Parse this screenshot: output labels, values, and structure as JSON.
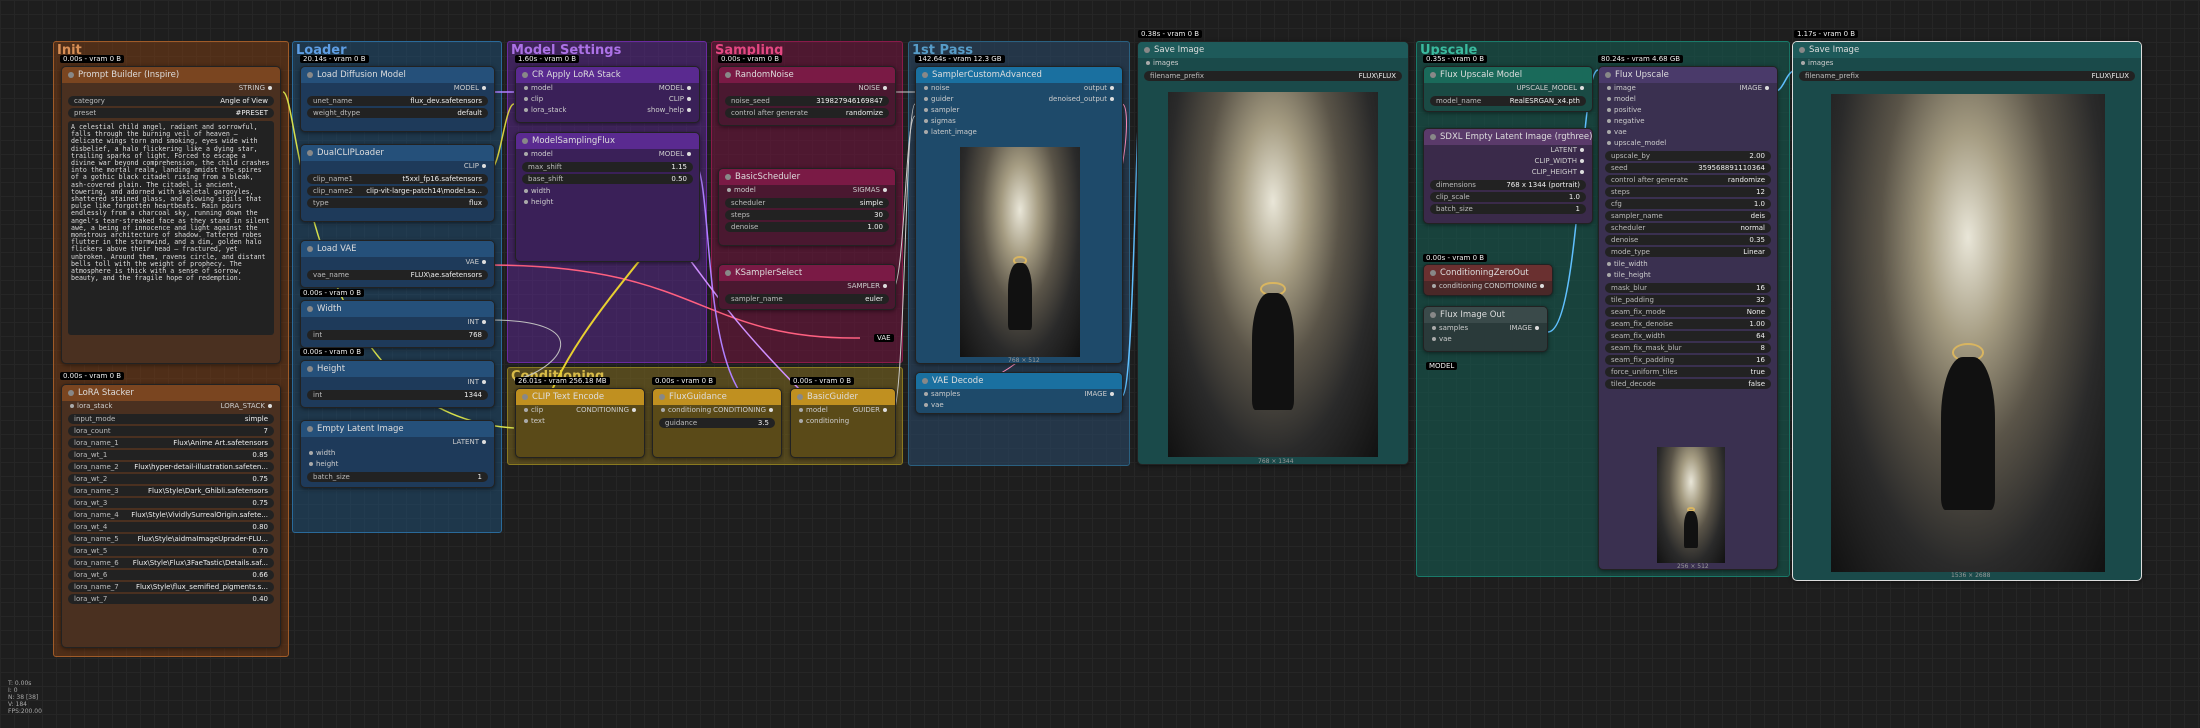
{
  "groups": {
    "init": "Init",
    "loader": "Loader",
    "model_settings": "Model Settings",
    "sampling": "Sampling",
    "first_pass": "1st Pass",
    "conditioning": "Conditioning",
    "upscale": "Upscale"
  },
  "badges": {
    "prompt_builder": "0.00s - vram 0 B",
    "loader": "20.14s - vram 0 B",
    "cr_lora": "1.60s - vram 0 B",
    "random_noise": "0.00s - vram 0 B",
    "sampler_adv": "142.64s - vram 12.3 GB",
    "save1": "0.38s - vram 0 B",
    "flux_upscale_model": "0.35s - vram 0 B",
    "flux_upscale": "80.24s - vram 4.68 GB",
    "save2": "1.17s - vram 0 B",
    "lora_stacker": "0.00s - vram 0 B",
    "width": "0.00s - vram 0 B",
    "height": "0.00s - vram 0 B",
    "conditioning": "26.01s - vram 256.18 MB",
    "cond2": "0.00s - vram 0 B",
    "cond3": "0.00s - vram 0 B",
    "cond_zero": "0.00s - vram 0 B"
  },
  "prompt_builder": {
    "title": "Prompt Builder (Inspire)",
    "out": "STRING",
    "category_label": "category",
    "category": "Angle of View",
    "preset_label": "preset",
    "preset": "#PRESET",
    "text": "A celestial child angel, radiant and sorrowful, falls through the burning veil of heaven — delicate wings torn and smoking, eyes wide with disbelief, a halo flickering like a dying star, trailing sparks of light. Forced to escape a divine war beyond comprehension, the child crashes into the mortal realm, landing amidst the spires of a gothic black citadel rising from a bleak, ash-covered plain. The citadel is ancient, towering, and adorned with skeletal gargoyles, shattered stained glass, and glowing sigils that pulse like forgotten heartbeats. Rain pours endlessly from a charcoal sky, running down the angel's tear-streaked face as they stand in silent awe, a being of innocence and light against the monstrous architecture of shadow. Tattered robes flutter in the stormwind, and a dim, golden halo flickers above their head — fractured, yet unbroken. Around them, ravens circle, and distant bells toll with the weight of prophecy. The atmosphere is thick with a sense of sorrow, beauty, and the fragile hope of redemption."
  },
  "lora_stacker": {
    "title": "LoRA Stacker",
    "out": "LORA_STACK",
    "in": "lora_stack",
    "rows": [
      [
        "input_mode",
        "simple"
      ],
      [
        "lora_count",
        "7"
      ],
      [
        "lora_name_1",
        "Flux\\Anime Art.safetensors"
      ],
      [
        "lora_wt_1",
        "0.85"
      ],
      [
        "lora_name_2",
        "Flux\\hyper-detail-illustration.safeten..."
      ],
      [
        "lora_wt_2",
        "0.75"
      ],
      [
        "lora_name_3",
        "Flux\\Style\\Dark_Ghibli.safetensors"
      ],
      [
        "lora_wt_3",
        "0.75"
      ],
      [
        "lora_name_4",
        "Flux\\Style\\VividlySurrealOrigin.safete..."
      ],
      [
        "lora_wt_4",
        "0.80"
      ],
      [
        "lora_name_5",
        "Flux\\Style\\aidmaImageUprader-FLU..."
      ],
      [
        "lora_wt_5",
        "0.70"
      ],
      [
        "lora_name_6",
        "Flux\\Style\\Flux\\3FaeTastic\\Details.saf..."
      ],
      [
        "lora_wt_6",
        "0.66"
      ],
      [
        "lora_name_7",
        "Flux\\Style\\flux_semified_pigments.s..."
      ],
      [
        "lora_wt_7",
        "0.40"
      ]
    ]
  },
  "load_diffusion": {
    "title": "Load Diffusion Model",
    "out": "MODEL",
    "unet_label": "unet_name",
    "unet": "flux_dev.safetensors",
    "dtype_label": "weight_dtype",
    "dtype": "default"
  },
  "dual_clip": {
    "title": "DualCLIPLoader",
    "out": "CLIP",
    "c1_label": "clip_name1",
    "c1": "t5xxl_fp16.safetensors",
    "c2_label": "clip_name2",
    "c2": "clip-vit-large-patch14\\model.sa...",
    "type_label": "type",
    "type": "flux"
  },
  "load_vae": {
    "title": "Load VAE",
    "out": "VAE",
    "vae_label": "vae_name",
    "vae": "FLUX\\ae.safetensors"
  },
  "width_node": {
    "title": "Width",
    "out": "INT",
    "label": "int",
    "value": "768"
  },
  "height_node": {
    "title": "Height",
    "out": "INT",
    "label": "int",
    "value": "1344"
  },
  "empty_latent": {
    "title": "Empty Latent Image",
    "out": "LATENT",
    "in1": "width",
    "in2": "height",
    "batch_label": "batch_size",
    "batch": "1"
  },
  "cr_lora": {
    "title": "CR Apply LoRA Stack",
    "in1": "model",
    "in2": "clip",
    "in3": "lora_stack",
    "out1": "MODEL",
    "out2": "CLIP",
    "out3": "show_help"
  },
  "model_sampling": {
    "title": "ModelSamplingFlux",
    "in1": "model",
    "in2": "width",
    "in3": "height",
    "out": "MODEL",
    "r1": [
      "max_shift",
      "1.15"
    ],
    "r2": [
      "base_shift",
      "0.50"
    ]
  },
  "random_noise": {
    "title": "RandomNoise",
    "out": "NOISE",
    "r1": [
      "noise_seed",
      "319827946169847"
    ],
    "r2": [
      "control after generate",
      "randomize"
    ]
  },
  "basic_scheduler": {
    "title": "BasicScheduler",
    "in": "model",
    "out": "SIGMAS",
    "r1": [
      "scheduler",
      "simple"
    ],
    "r2": [
      "steps",
      "30"
    ],
    "r3": [
      "denoise",
      "1.00"
    ]
  },
  "ksampler_select": {
    "title": "KSamplerSelect",
    "out": "SAMPLER",
    "r1": [
      "sampler_name",
      "euler"
    ]
  },
  "sampler_adv": {
    "title": "SamplerCustomAdvanced",
    "ins": [
      "noise",
      "guider",
      "sampler",
      "sigmas",
      "latent_image"
    ],
    "out1": "output",
    "out2": "denoised_output",
    "cap": "768 × 512"
  },
  "vae_decode": {
    "title": "VAE Decode",
    "in1": "samples",
    "in2": "vae",
    "out": "IMAGE",
    "vae_label": "VAE"
  },
  "cond_clip": {
    "title": "CLIP Text Encode",
    "in1": "clip",
    "in2": "text",
    "out": "CONDITIONING"
  },
  "flux_guidance": {
    "title": "FluxGuidance",
    "in": "conditioning",
    "out": "CONDITIONING",
    "r1": [
      "guidance",
      "3.5"
    ]
  },
  "basic_guider": {
    "title": "BasicGuider",
    "in1": "model",
    "in2": "conditioning",
    "out": "GUIDER"
  },
  "save1": {
    "title": "Save Image",
    "in": "images",
    "prefix_label": "filename_prefix",
    "prefix": "FLUX\\FLUX",
    "cap": "768 × 1344"
  },
  "flux_up_model": {
    "title": "Flux Upscale Model",
    "out": "UPSCALE_MODEL",
    "label": "model_name",
    "value": "RealESRGAN_x4.pth"
  },
  "sdxl_latent": {
    "title": "SDXL Empty Latent Image (rgthree)",
    "out1": "LATENT",
    "out2": "CLIP_WIDTH",
    "out3": "CLIP_HEIGHT",
    "r1": [
      "dimensions",
      "768 x 1344  (portrait)"
    ],
    "r2": [
      "clip_scale",
      "1.0"
    ],
    "r3": [
      "batch_size",
      "1"
    ]
  },
  "cond_zero": {
    "title": "ConditioningZeroOut",
    "in": "conditioning",
    "out": "CONDITIONING",
    "out_top": "CONDITIONING"
  },
  "flux_img_out": {
    "title": "Flux Image Out",
    "in1": "samples",
    "in2": "vae",
    "out": "IMAGE",
    "model": "MODEL"
  },
  "flux_upscale": {
    "title": "Flux Upscale",
    "out": "IMAGE",
    "ins": [
      "image",
      "model",
      "positive",
      "negative",
      "vae",
      "upscale_model"
    ],
    "rows": [
      [
        "upscale_by",
        "2.00"
      ],
      [
        "seed",
        "359568891110364"
      ],
      [
        "control after generate",
        "randomize"
      ],
      [
        "steps",
        "12"
      ],
      [
        "cfg",
        "1.0"
      ],
      [
        "sampler_name",
        "deis"
      ],
      [
        "scheduler",
        "normal"
      ],
      [
        "denoise",
        "0.35"
      ],
      [
        "mode_type",
        "Linear"
      ]
    ],
    "tile_w": "tile_width",
    "tile_h": "tile_height",
    "rows2": [
      [
        "mask_blur",
        "16"
      ],
      [
        "tile_padding",
        "32"
      ],
      [
        "seam_fix_mode",
        "None"
      ],
      [
        "seam_fix_denoise",
        "1.00"
      ],
      [
        "seam_fix_width",
        "64"
      ],
      [
        "seam_fix_mask_blur",
        "8"
      ],
      [
        "seam_fix_padding",
        "16"
      ],
      [
        "force_uniform_tiles",
        "true"
      ],
      [
        "tiled_decode",
        "false"
      ]
    ],
    "cap": "256 × 512"
  },
  "save2": {
    "title": "Save Image",
    "in": "images",
    "prefix_label": "filename_prefix",
    "prefix": "FLUX\\FLUX",
    "cap": "1536 × 2688"
  },
  "stats": {
    "t": "T: 0.00s",
    "i": "I: 0",
    "n": "N: 38 [38]",
    "v": "V: 184",
    "fps": "FPS:200.00"
  }
}
